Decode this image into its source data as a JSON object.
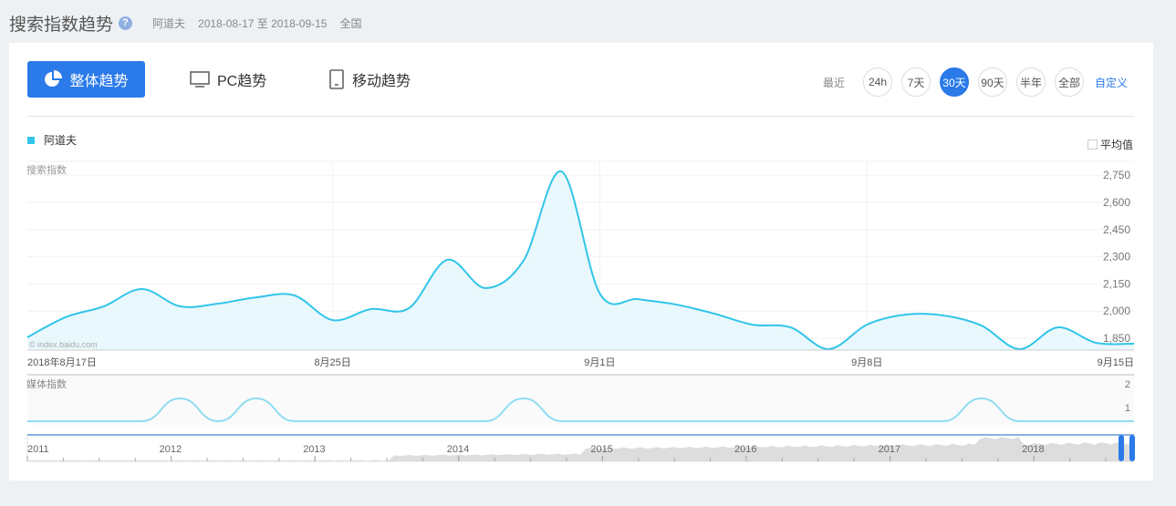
{
  "header": {
    "title": "搜索指数趋势",
    "help": "?",
    "keyword": "阿道夫",
    "date_range": "2018-08-17 至 2018-09-15",
    "region": "全国"
  },
  "tabs": [
    {
      "label": "整体趋势",
      "icon": "pie-chart-icon"
    },
    {
      "label": "PC趋势",
      "icon": "monitor-icon"
    },
    {
      "label": "移动趋势",
      "icon": "tablet-icon"
    }
  ],
  "range": {
    "label": "最近",
    "options": [
      "24h",
      "7天",
      "30天",
      "90天",
      "半年",
      "全部"
    ],
    "selected": "30天",
    "custom": "自定义"
  },
  "legend": {
    "series": "阿道夫",
    "avg_label": "平均值"
  },
  "colors": {
    "accent": "#2a7ae9",
    "series": "#32c5e9",
    "media": "#8fdcf2"
  },
  "watermark": "© index.baidu.com",
  "chart_data": [
    {
      "type": "area",
      "title": "搜索指数",
      "x_start": "2018-08-17",
      "x_ticks": [
        {
          "i": 0,
          "label": "2018年8月17日"
        },
        {
          "i": 8,
          "label": "8月25日"
        },
        {
          "i": 15,
          "label": "9月1日"
        },
        {
          "i": 22,
          "label": "9月8日"
        },
        {
          "i": 29,
          "label": "9月15日"
        }
      ],
      "y_ticks": [
        "1,850",
        "2,000",
        "2,150",
        "2,300",
        "2,450",
        "2,600",
        "2,750"
      ],
      "ylim": [
        1785,
        2800
      ],
      "series": [
        {
          "name": "阿道夫",
          "values": [
            1855,
            1966,
            2026,
            2122,
            2026,
            2041,
            2076,
            2086,
            1950,
            2011,
            2016,
            2283,
            2127,
            2278,
            2770,
            2097,
            2066,
            2036,
            1986,
            1925,
            1910,
            1790,
            1925,
            1980,
            1976,
            1920,
            1790,
            1910,
            1825,
            1820
          ]
        }
      ]
    },
    {
      "type": "line",
      "title": "媒体指数",
      "y_ticks": [
        "1",
        "2"
      ],
      "series": [
        {
          "name": "阿道夫",
          "values": [
            0,
            0,
            0,
            0,
            1,
            0,
            1,
            0,
            0,
            0,
            0,
            0,
            0,
            1,
            0,
            0,
            0,
            0,
            0,
            0,
            0,
            0,
            0,
            0,
            0,
            1,
            0,
            0,
            0,
            0
          ]
        }
      ]
    },
    {
      "type": "area",
      "title": "overview",
      "x_ticks": [
        "2011",
        "2012",
        "2013",
        "2014",
        "2015",
        "2016",
        "2017",
        "2018"
      ]
    }
  ]
}
